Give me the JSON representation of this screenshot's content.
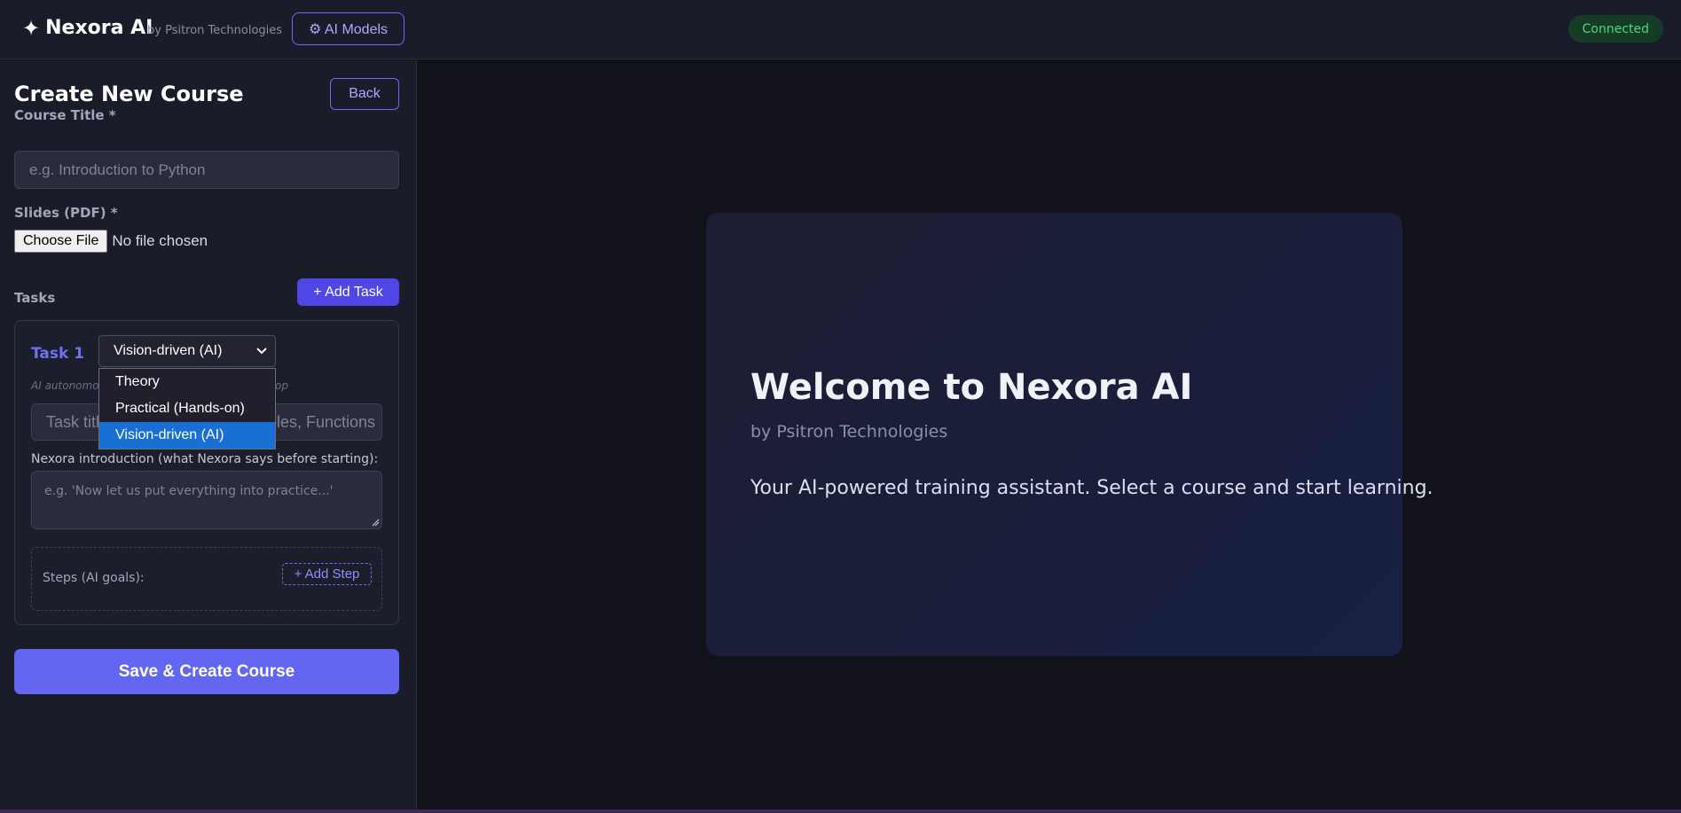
{
  "header": {
    "logo_icon": "sparkle-icon",
    "app_name": "Nexora AI",
    "byline": "by Psitron Technologies",
    "models_button": "⚙ AI Models",
    "status": "Connected"
  },
  "form": {
    "title": "Create New Course",
    "back_label": "Back",
    "course_title_label": "Course Title *",
    "course_title_placeholder": "e.g. Introduction to Python",
    "slides_label": "Slides (PDF) *",
    "choose_file_label": "Choose File",
    "file_status": "No file chosen",
    "tasks_label": "Tasks",
    "add_task_label": "+ Add Task",
    "task": {
      "name": "Task 1",
      "type_selected": "Vision-driven (AI)",
      "type_options": [
        "Theory",
        "Practical (Hands-on)",
        "Vision-driven (AI)"
      ],
      "hint_start": "AI autonomo",
      "hint_end": "op",
      "title_placeholder_start": "Task titl",
      "title_placeholder_end": "bles, Functions",
      "intro_label": "Nexora introduction (what Nexora says before starting):",
      "intro_placeholder": "e.g. 'Now let us put everything into practice...'",
      "steps_label": "Steps (AI goals):",
      "add_step_label": "+ Add Step"
    },
    "save_label": "Save & Create Course"
  },
  "welcome": {
    "title": "Welcome to Nexora AI",
    "byline": "by Psitron Technologies",
    "description": "Your AI-powered training assistant. Select a course and start learning."
  },
  "colors": {
    "accent": "#6366f1",
    "status_green": "#4cd97b",
    "dropdown_selected": "#1a6fd4"
  }
}
